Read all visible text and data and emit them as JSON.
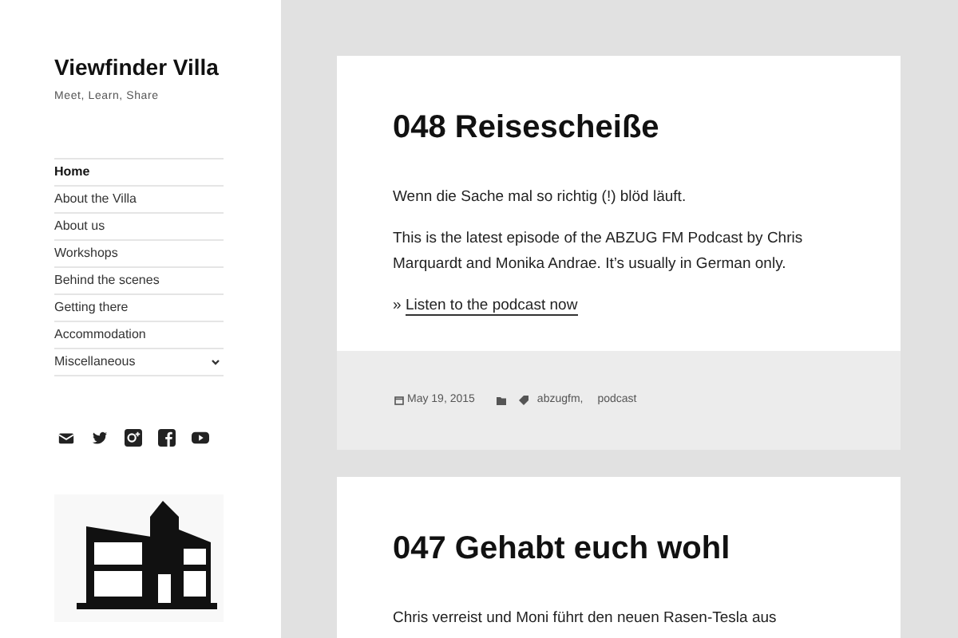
{
  "site": {
    "title": "Viewfinder Villa",
    "tagline": "Meet, Learn, Share"
  },
  "menu": [
    {
      "label": "Home",
      "selected": true,
      "submenu": false
    },
    {
      "label": "About the Villa",
      "selected": false,
      "submenu": false
    },
    {
      "label": "About us",
      "selected": false,
      "submenu": false
    },
    {
      "label": "Workshops",
      "selected": false,
      "submenu": false
    },
    {
      "label": "Behind the scenes",
      "selected": false,
      "submenu": false
    },
    {
      "label": "Getting there",
      "selected": false,
      "submenu": false
    },
    {
      "label": "Accommodation",
      "selected": false,
      "submenu": false
    },
    {
      "label": "Miscellaneous",
      "selected": false,
      "submenu": true
    }
  ],
  "social": [
    {
      "kind": "mail"
    },
    {
      "kind": "twitter"
    },
    {
      "kind": "gplus"
    },
    {
      "kind": "facebook"
    },
    {
      "kind": "youtube"
    }
  ],
  "posts": [
    {
      "title": "048 Reisescheiße",
      "paragraphs": [
        "Wenn die Sache mal so richtig (!) blöd läuft.",
        "This is the latest episode of the ABZUG FM Podcast by Chris Marquardt and Monika Andrae. It’s usually in German only."
      ],
      "link_prefix": "»",
      "link": "Listen to the podcast now",
      "date": "May 19, 2015",
      "tags": [
        "abzugfm,",
        "podcast"
      ]
    },
    {
      "title": "047 Gehabt euch wohl",
      "paragraphs": [
        "Chris verreist und Moni führt den neuen Rasen-Tesla aus"
      ]
    }
  ]
}
